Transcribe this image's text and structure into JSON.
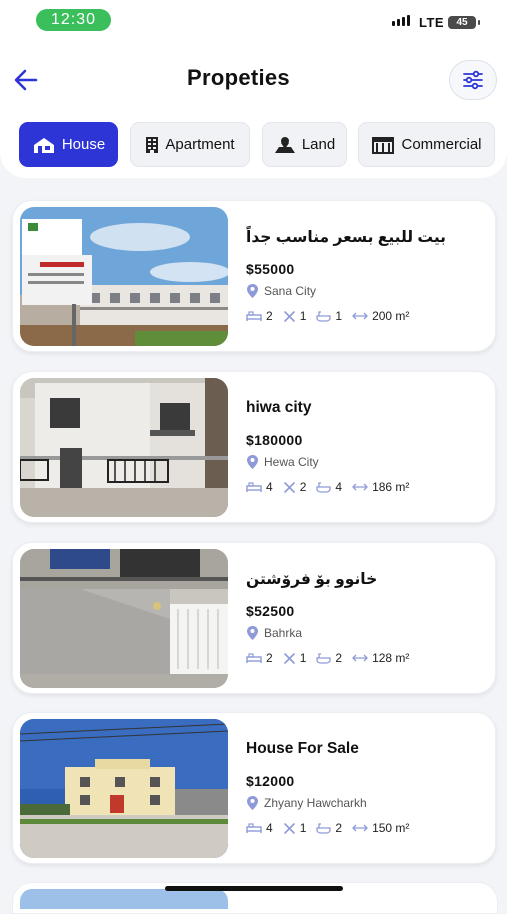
{
  "status_bar": {
    "time": "12:30",
    "network": "LTE",
    "battery": "45"
  },
  "header": {
    "title": "Propeties",
    "back_icon": "arrow-left-icon",
    "filter_icon": "sliders-icon"
  },
  "tabs": [
    {
      "label": "House",
      "icon": "house-icon",
      "active": true
    },
    {
      "label": "Apartment",
      "icon": "building-icon",
      "active": false
    },
    {
      "label": "Land",
      "icon": "land-icon",
      "active": false
    },
    {
      "label": "Commercial",
      "icon": "shop-icon",
      "active": false
    }
  ],
  "listings": [
    {
      "title": "بيت للبيع بسعر مناسب جداً",
      "price": "$55000",
      "location": "Sana City",
      "beds": "2",
      "baths": "1",
      "floors": "1",
      "area": "200 m²"
    },
    {
      "title": "hiwa city",
      "price": "$180000",
      "location": "Hewa City",
      "beds": "4",
      "baths": "2",
      "floors": "4",
      "area": "186 m²"
    },
    {
      "title": "خانوو بۆ فرۆشتن",
      "price": "$52500",
      "location": "Bahrka",
      "beds": "2",
      "baths": "1",
      "floors": "2",
      "area": "128 m²"
    },
    {
      "title": "House For Sale",
      "price": "$12000",
      "location": "Zhyany Hawcharkh",
      "beds": "4",
      "baths": "1",
      "floors": "2",
      "area": "150 m²"
    }
  ],
  "colors": {
    "accent": "#2d35d6",
    "location_pin": "#8f9bd8",
    "status_time_bg": "#3bbf5c"
  }
}
